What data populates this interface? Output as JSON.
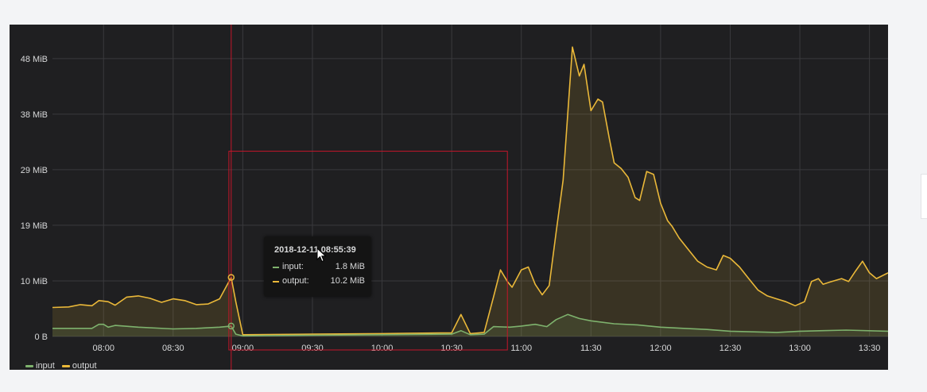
{
  "chart_data": {
    "type": "area",
    "x_unit": "time",
    "x_ticks": [
      "08:00",
      "08:30",
      "09:00",
      "09:30",
      "10:00",
      "10:30",
      "11:00",
      "11:30",
      "12:00",
      "12:30",
      "13:00",
      "13:30"
    ],
    "y_ticks": [
      "0 B",
      "10 MiB",
      "19 MiB",
      "29 MiB",
      "38 MiB",
      "48 MiB"
    ],
    "ylim": [
      0,
      54
    ],
    "xlim": [
      "07:38",
      "13:38"
    ],
    "grid": true,
    "legend_position": "bottom-left",
    "series": [
      {
        "name": "input",
        "color": "#7eb26d",
        "points": [
          [
            "07:38",
            1.4
          ],
          [
            "07:55",
            1.4
          ],
          [
            "07:58",
            2.1
          ],
          [
            "08:00",
            2.1
          ],
          [
            "08:02",
            1.6
          ],
          [
            "08:05",
            1.9
          ],
          [
            "08:15",
            1.6
          ],
          [
            "08:30",
            1.3
          ],
          [
            "08:40",
            1.4
          ],
          [
            "08:50",
            1.6
          ],
          [
            "08:55",
            1.8
          ],
          [
            "08:57",
            0.4
          ],
          [
            "09:00",
            0.1
          ],
          [
            "09:30",
            0.2
          ],
          [
            "10:00",
            0.3
          ],
          [
            "10:30",
            0.4
          ],
          [
            "10:34",
            1.0
          ],
          [
            "10:38",
            0.3
          ],
          [
            "10:44",
            0.4
          ],
          [
            "10:48",
            1.7
          ],
          [
            "10:55",
            1.6
          ],
          [
            "11:00",
            1.8
          ],
          [
            "11:06",
            2.1
          ],
          [
            "11:11",
            1.7
          ],
          [
            "11:15",
            2.9
          ],
          [
            "11:20",
            3.8
          ],
          [
            "11:25",
            3.1
          ],
          [
            "11:30",
            2.7
          ],
          [
            "11:40",
            2.2
          ],
          [
            "11:50",
            2.0
          ],
          [
            "12:00",
            1.6
          ],
          [
            "12:10",
            1.4
          ],
          [
            "12:20",
            1.2
          ],
          [
            "12:30",
            0.9
          ],
          [
            "12:40",
            0.8
          ],
          [
            "12:50",
            0.7
          ],
          [
            "13:00",
            0.9
          ],
          [
            "13:10",
            1.0
          ],
          [
            "13:20",
            1.1
          ],
          [
            "13:38",
            0.9
          ]
        ]
      },
      {
        "name": "output",
        "color": "#eab839",
        "points": [
          [
            "07:38",
            5.0
          ],
          [
            "07:45",
            5.1
          ],
          [
            "07:50",
            5.5
          ],
          [
            "07:55",
            5.3
          ],
          [
            "07:58",
            6.2
          ],
          [
            "08:02",
            6.0
          ],
          [
            "08:05",
            5.4
          ],
          [
            "08:10",
            6.8
          ],
          [
            "08:15",
            7.0
          ],
          [
            "08:20",
            6.6
          ],
          [
            "08:25",
            5.9
          ],
          [
            "08:30",
            6.5
          ],
          [
            "08:35",
            6.2
          ],
          [
            "08:40",
            5.5
          ],
          [
            "08:45",
            5.6
          ],
          [
            "08:50",
            6.5
          ],
          [
            "08:55",
            10.2
          ],
          [
            "08:57",
            6.0
          ],
          [
            "09:00",
            0.3
          ],
          [
            "09:30",
            0.4
          ],
          [
            "10:00",
            0.5
          ],
          [
            "10:25",
            0.6
          ],
          [
            "10:30",
            0.6
          ],
          [
            "10:34",
            3.8
          ],
          [
            "10:38",
            0.5
          ],
          [
            "10:44",
            0.7
          ],
          [
            "10:48",
            6.8
          ],
          [
            "10:51",
            11.5
          ],
          [
            "10:54",
            9.5
          ],
          [
            "10:56",
            8.5
          ],
          [
            "11:00",
            11.5
          ],
          [
            "11:03",
            12.0
          ],
          [
            "11:06",
            9.0
          ],
          [
            "11:09",
            7.2
          ],
          [
            "11:12",
            8.8
          ],
          [
            "11:15",
            18.0
          ],
          [
            "11:18",
            27.0
          ],
          [
            "11:22",
            50.0
          ],
          [
            "11:25",
            45.0
          ],
          [
            "11:27",
            47.0
          ],
          [
            "11:30",
            39.0
          ],
          [
            "11:33",
            41.0
          ],
          [
            "11:35",
            40.5
          ],
          [
            "11:38",
            34.0
          ],
          [
            "11:40",
            30.0
          ],
          [
            "11:43",
            29.0
          ],
          [
            "11:46",
            27.5
          ],
          [
            "11:49",
            24.0
          ],
          [
            "11:51",
            23.5
          ],
          [
            "11:54",
            28.5
          ],
          [
            "11:57",
            28.0
          ],
          [
            "12:00",
            23.0
          ],
          [
            "12:03",
            20.0
          ],
          [
            "12:05",
            19.0
          ],
          [
            "12:08",
            17.0
          ],
          [
            "12:12",
            15.0
          ],
          [
            "12:16",
            13.0
          ],
          [
            "12:20",
            12.0
          ],
          [
            "12:24",
            11.5
          ],
          [
            "12:27",
            14.0
          ],
          [
            "12:30",
            13.5
          ],
          [
            "12:34",
            12.0
          ],
          [
            "12:38",
            10.0
          ],
          [
            "12:42",
            8.0
          ],
          [
            "12:46",
            7.0
          ],
          [
            "12:50",
            6.5
          ],
          [
            "12:54",
            6.0
          ],
          [
            "12:58",
            5.3
          ],
          [
            "13:02",
            6.0
          ],
          [
            "13:05",
            9.5
          ],
          [
            "13:08",
            10.0
          ],
          [
            "13:10",
            9.0
          ],
          [
            "13:13",
            9.4
          ],
          [
            "13:18",
            10.0
          ],
          [
            "13:21",
            9.5
          ],
          [
            "13:24",
            11.3
          ],
          [
            "13:27",
            13.0
          ],
          [
            "13:30",
            11.0
          ],
          [
            "13:33",
            10.0
          ],
          [
            "13:38",
            11.0
          ]
        ]
      }
    ],
    "annotations": {
      "selection_box": {
        "x_start": "08:54",
        "x_end": "10:54",
        "y_top": 32
      },
      "vertical_marker": "08:55"
    }
  },
  "tooltip": {
    "time": "2018-12-11 08:55:39",
    "rows": [
      {
        "label": "input:",
        "value": "1.8 MiB",
        "color": "#7eb26d"
      },
      {
        "label": "output:",
        "value": "10.2 MiB",
        "color": "#eab839"
      }
    ]
  },
  "legend": {
    "items": [
      {
        "label": "input",
        "color": "#7eb26d"
      },
      {
        "label": "output",
        "color": "#eab839"
      }
    ]
  },
  "colors": {
    "panel_background": "#1f1f21",
    "page_background": "#f3f4f6",
    "grid": "#3a3a3d",
    "marker": "#c4162a",
    "text": "#d8d9da"
  }
}
